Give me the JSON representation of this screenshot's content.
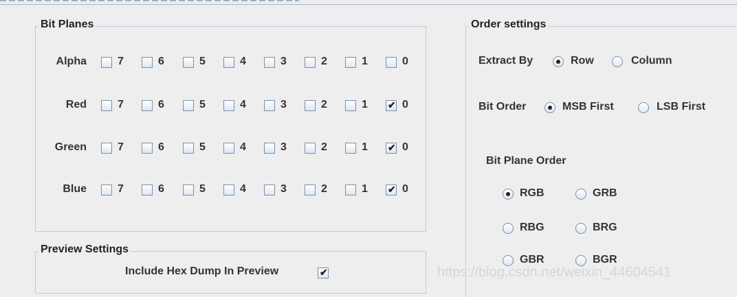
{
  "bit_planes": {
    "title": "Bit Planes",
    "rows": [
      {
        "label": "Alpha",
        "bits": [
          {
            "label": "7",
            "checked": false
          },
          {
            "label": "6",
            "checked": false
          },
          {
            "label": "5",
            "checked": false
          },
          {
            "label": "4",
            "checked": false
          },
          {
            "label": "3",
            "checked": false
          },
          {
            "label": "2",
            "checked": false
          },
          {
            "label": "1",
            "checked": false
          },
          {
            "label": "0",
            "checked": false
          }
        ]
      },
      {
        "label": "Red",
        "bits": [
          {
            "label": "7",
            "checked": false
          },
          {
            "label": "6",
            "checked": false
          },
          {
            "label": "5",
            "checked": false
          },
          {
            "label": "4",
            "checked": false
          },
          {
            "label": "3",
            "checked": false
          },
          {
            "label": "2",
            "checked": false
          },
          {
            "label": "1",
            "checked": false
          },
          {
            "label": "0",
            "checked": true
          }
        ]
      },
      {
        "label": "Green",
        "bits": [
          {
            "label": "7",
            "checked": false
          },
          {
            "label": "6",
            "checked": false
          },
          {
            "label": "5",
            "checked": false
          },
          {
            "label": "4",
            "checked": false
          },
          {
            "label": "3",
            "checked": false
          },
          {
            "label": "2",
            "checked": false
          },
          {
            "label": "1",
            "checked": false
          },
          {
            "label": "0",
            "checked": true
          }
        ]
      },
      {
        "label": "Blue",
        "bits": [
          {
            "label": "7",
            "checked": false
          },
          {
            "label": "6",
            "checked": false
          },
          {
            "label": "5",
            "checked": false
          },
          {
            "label": "4",
            "checked": false
          },
          {
            "label": "3",
            "checked": false
          },
          {
            "label": "2",
            "checked": false
          },
          {
            "label": "1",
            "checked": false
          },
          {
            "label": "0",
            "checked": true
          }
        ]
      }
    ]
  },
  "preview_settings": {
    "title": "Preview Settings",
    "hex_dump_label": "Include Hex Dump In Preview",
    "hex_dump_checked": true
  },
  "order_settings": {
    "title": "Order settings",
    "extract_by": {
      "label": "Extract By",
      "options": [
        "Row",
        "Column"
      ],
      "selected": "Row"
    },
    "bit_order": {
      "label": "Bit Order",
      "options": [
        "MSB First",
        "LSB First"
      ],
      "selected": "MSB First"
    },
    "bit_plane_order": {
      "label": "Bit Plane Order",
      "options": [
        "RGB",
        "GRB",
        "RBG",
        "BRG",
        "GBR",
        "BGR"
      ],
      "selected": "RGB"
    }
  },
  "watermark": "https://blog.csdn.net/weixin_44604541"
}
